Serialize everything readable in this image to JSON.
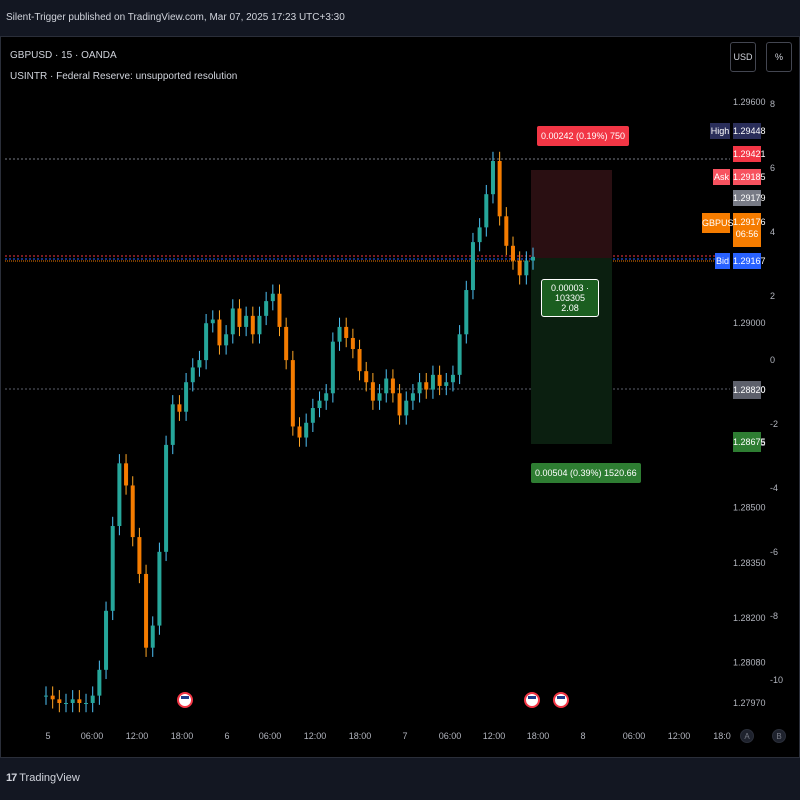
{
  "header": {
    "publisher": "Silent-Trigger published on TradingView.com, Mar 07, 2025 17:23 UTC+3:30"
  },
  "legend": {
    "symbol_line": "GBPUSD · 15 · OANDA",
    "indicator_line": "USINTR · Federal Reserve: unsupported resolution"
  },
  "toolbar": {
    "currency_button": "USD",
    "percent_button": "%"
  },
  "price_axis": {
    "ticks": [
      "1.29600",
      "1.29000",
      "1.28820",
      "1.28675",
      "1.28500",
      "1.28350",
      "1.28200",
      "1.28080",
      "1.27970"
    ],
    "tick_values": [
      1.296,
      1.29,
      1.2882,
      1.28675,
      1.285,
      1.2835,
      1.282,
      1.2808,
      1.2797
    ]
  },
  "secondary_axis": {
    "ticks": [
      "8",
      "6",
      "4",
      "2",
      "0",
      "-2",
      "-4",
      "-6",
      "-8",
      "-10"
    ]
  },
  "price_labels": {
    "high": {
      "tag": "High",
      "value": "1.29448",
      "color": "#2a2e5a"
    },
    "red_line": {
      "value": "1.29421",
      "color": "#f23645"
    },
    "ask": {
      "tag": "Ask",
      "value": "1.29185",
      "color": "#f7525f"
    },
    "gray": {
      "value": "1.29179",
      "color": "#787b86"
    },
    "current": {
      "tag": "GBPUSD",
      "value": "1.29176",
      "countdown": "06:56",
      "color": "#f57c00"
    },
    "bid": {
      "tag": "Bid",
      "value": "1.29167",
      "color": "#2962ff"
    },
    "entry": {
      "value": "1.28820",
      "color": "#5d606b"
    },
    "target": {
      "value": "1.28675",
      "color": "#2e7d32"
    }
  },
  "position_tool": {
    "stop_label": "0.00242 (0.19%) 750",
    "entry_label_line1": "0.00003 · 103305",
    "entry_label_line2": "2.08",
    "target_label": "0.00504 (0.39%) 1520.66"
  },
  "time_axis": {
    "labels": [
      "5",
      "06:00",
      "12:00",
      "18:00",
      "6",
      "06:00",
      "12:00",
      "18:00",
      "7",
      "06:00",
      "12:00",
      "18:00",
      "8",
      "06:00",
      "12:00",
      "18:0"
    ]
  },
  "events": [
    {
      "icon": "us-flag-icon"
    },
    {
      "icon": "us-flag-icon"
    },
    {
      "icon": "us-flag-icon"
    }
  ],
  "axis_buttons": {
    "auto": "A",
    "log": "B"
  },
  "footer": {
    "brand": "TradingView",
    "mark": "17"
  },
  "chart_data": {
    "type": "line",
    "series": [
      {
        "values": [
          1.2799,
          1.2798,
          1.2797,
          1.2797,
          1.2798,
          1.2797,
          1.2797,
          1.2799,
          1.2806,
          1.2822,
          1.2845,
          1.2862,
          1.2856,
          1.2842,
          1.2832,
          1.2812,
          1.2818,
          1.2838,
          1.2867,
          1.2878,
          1.2876,
          1.2884,
          1.2888,
          1.289,
          1.29,
          1.2901,
          1.2894,
          1.2897,
          1.2904,
          1.2899,
          1.2902,
          1.2897,
          1.2902,
          1.2906,
          1.2908,
          1.2899,
          1.289,
          1.2872,
          1.2869,
          1.2873,
          1.2877,
          1.2879,
          1.2881,
          1.2895,
          1.2899,
          1.2896,
          1.2893,
          1.2887,
          1.2884,
          1.2879,
          1.2881,
          1.2885,
          1.2881,
          1.2875,
          1.2879,
          1.2881,
          1.2884,
          1.2882,
          1.2886,
          1.2883,
          1.2884,
          1.2886,
          1.2897,
          1.2909,
          1.2922,
          1.2926,
          1.2935,
          1.2944,
          1.2929,
          1.2921,
          1.2917,
          1.2913,
          1.2917,
          1.2918
        ]
      }
    ],
    "ylim": [
      1.2797,
      1.296
    ]
  }
}
